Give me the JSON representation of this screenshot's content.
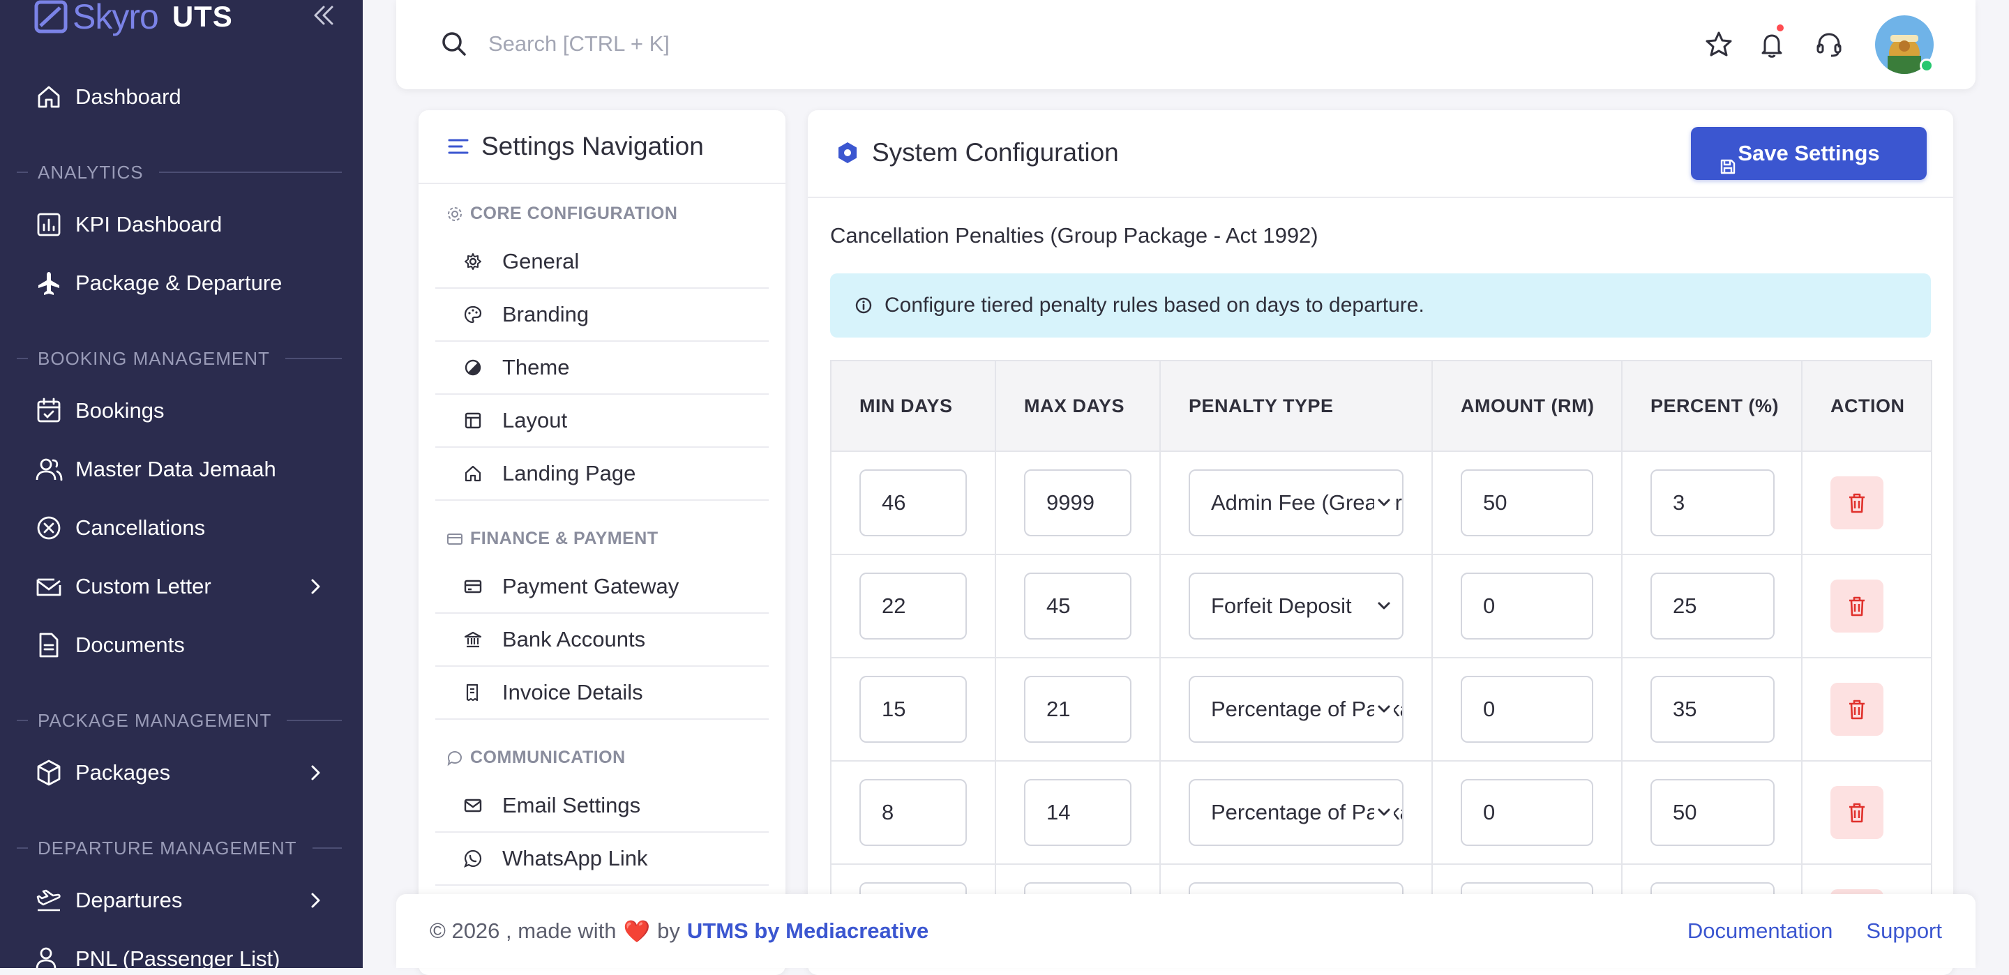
{
  "sidebar": {
    "brand_name": "Skyro",
    "brand_sub": "UTS",
    "items": [
      {
        "label": "Dashboard",
        "icon": "home-icon"
      },
      {
        "label": "KPI Dashboard",
        "icon": "chart-icon"
      },
      {
        "label": "Package & Departure",
        "icon": "plane-icon"
      },
      {
        "label": "Bookings",
        "icon": "calendar-check-icon"
      },
      {
        "label": "Master Data Jemaah",
        "icon": "users-icon"
      },
      {
        "label": "Cancellations",
        "icon": "x-circle-icon"
      },
      {
        "label": "Custom Letter",
        "icon": "mail-icon"
      },
      {
        "label": "Documents",
        "icon": "file-icon"
      },
      {
        "label": "Packages",
        "icon": "box-icon"
      },
      {
        "label": "Departures",
        "icon": "plane-departure-icon"
      },
      {
        "label": "PNL (Passenger List)",
        "icon": "user-icon"
      }
    ],
    "headers": {
      "analytics": "ANALYTICS",
      "booking": "BOOKING MANAGEMENT",
      "package": "PACKAGE MANAGEMENT",
      "departure": "DEPARTURE MANAGEMENT"
    }
  },
  "topbar": {
    "search_placeholder": "Search [CTRL + K]"
  },
  "settings_nav": {
    "title": "Settings Navigation",
    "groups": {
      "core": "CORE CONFIGURATION",
      "finance": "FINANCE & PAYMENT",
      "communication": "COMMUNICATION"
    },
    "items": [
      {
        "label": "General",
        "icon": "gear-icon"
      },
      {
        "label": "Branding",
        "icon": "palette-icon"
      },
      {
        "label": "Theme",
        "icon": "theme-icon"
      },
      {
        "label": "Layout",
        "icon": "layout-icon"
      },
      {
        "label": "Landing Page",
        "icon": "home-icon"
      },
      {
        "label": "Payment Gateway",
        "icon": "credit-card-icon"
      },
      {
        "label": "Bank Accounts",
        "icon": "bank-icon"
      },
      {
        "label": "Invoice Details",
        "icon": "invoice-icon"
      },
      {
        "label": "Email Settings",
        "icon": "mail-icon"
      },
      {
        "label": "WhatsApp Link",
        "icon": "whatsapp-icon"
      }
    ]
  },
  "main": {
    "title": "System Configuration",
    "save_label": "Save Settings",
    "section_title": "Cancellation Penalties (Group Package - Act 1992)",
    "alert_text": "Configure tiered penalty rules based on days to departure.",
    "columns": [
      "MIN DAYS",
      "MAX DAYS",
      "PENALTY TYPE",
      "AMOUNT (RM)",
      "PERCENT (%)",
      "ACTION"
    ],
    "rows": [
      {
        "min": "46",
        "max": "9999",
        "type": "Admin Fee (Greater of)",
        "amount": "50",
        "percent": "3"
      },
      {
        "min": "22",
        "max": "45",
        "type": "Forfeit Deposit",
        "amount": "0",
        "percent": "25"
      },
      {
        "min": "15",
        "max": "21",
        "type": "Percentage of Package",
        "amount": "0",
        "percent": "35"
      },
      {
        "min": "8",
        "max": "14",
        "type": "Percentage of Package",
        "amount": "0",
        "percent": "50"
      },
      {
        "min": "",
        "max": "",
        "type": "",
        "amount": "",
        "percent": ""
      }
    ]
  },
  "footer": {
    "copyright": "© 2026 , made with",
    "heart": "❤️",
    "by": "by",
    "brand_link": "UTMS by Mediacreative",
    "links": [
      "Documentation",
      "Support"
    ]
  },
  "colors": {
    "sidebar_bg": "#2b2c4e",
    "accent": "#3b56d0",
    "alert_bg": "#d7f3fb",
    "danger_bg": "#fde1e1",
    "danger": "#e0312c"
  }
}
